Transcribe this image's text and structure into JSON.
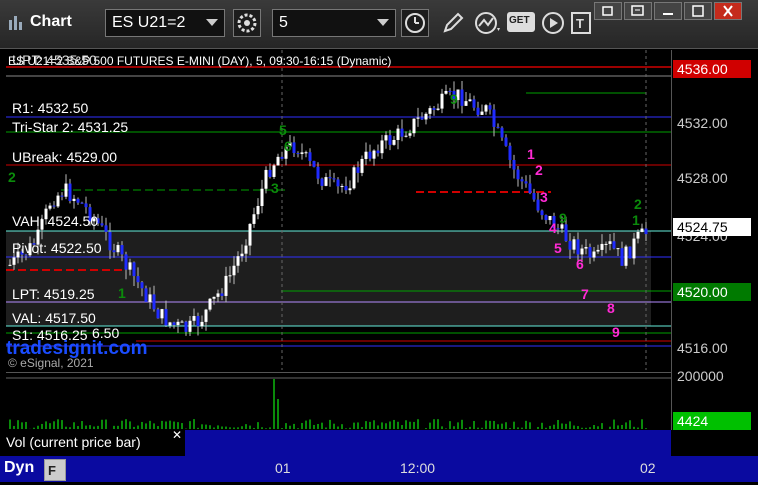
{
  "window": {
    "title": "Chart",
    "symbol": "ES U21=2",
    "interval": "5",
    "controls": [
      "restore-icon",
      "maximize-icon",
      "minimize-icon",
      "close-icon"
    ]
  },
  "toolbar": {
    "icons": [
      "gear-icon",
      "clock-icon",
      "pencil-icon",
      "indicator-icon",
      "get-icon",
      "play-icon",
      "text-icon"
    ],
    "get_label": "GET"
  },
  "chart": {
    "header": "ES U21=2 S&P 500 FUTURES E-MINI (DAY), 5, 09:30-16:15 (Dynamic)",
    "watermark": "tradesignit.com",
    "copyright": "© eSignal, 2021",
    "price_labels": [
      "4532.00",
      "4528.00",
      "4524.00",
      "4516.00"
    ],
    "price_tags": [
      {
        "text": "4536.00",
        "bg": "#d00000",
        "color": "#ffffff"
      },
      {
        "text": "4524.75",
        "bg": "#ffffff",
        "color": "#000000"
      },
      {
        "text": "4520.00",
        "bg": "#007a00",
        "color": "#ffffff"
      }
    ],
    "levels": {
      "upt": "UPT: 4535.50",
      "r1": "R1: 4532.50",
      "tristar": "Tri-Star 2: 4531.25",
      "ubreak": "UBreak: 4529.00",
      "vah": "VAH: 4524.50",
      "pivot": "Pivot: 4522.50",
      "lpt": "LPT: 4519.25",
      "val": "VAL: 4517.50",
      "s1": "S1: 4516.25",
      "s1b": "6.50"
    },
    "td_counts": [
      "1",
      "2",
      "3",
      "4",
      "5",
      "6",
      "7",
      "8",
      "9"
    ],
    "green_counts": [
      "9",
      "5",
      "6",
      "3",
      "2",
      "1",
      "2",
      "1",
      "9"
    ]
  },
  "volume": {
    "caption": "Vol (current price bar)",
    "axis_label": "200000",
    "tag": "4424"
  },
  "time_axis": {
    "labels": [
      "01",
      "12:00",
      "02"
    ]
  },
  "status": {
    "mode": "Dyn"
  }
}
